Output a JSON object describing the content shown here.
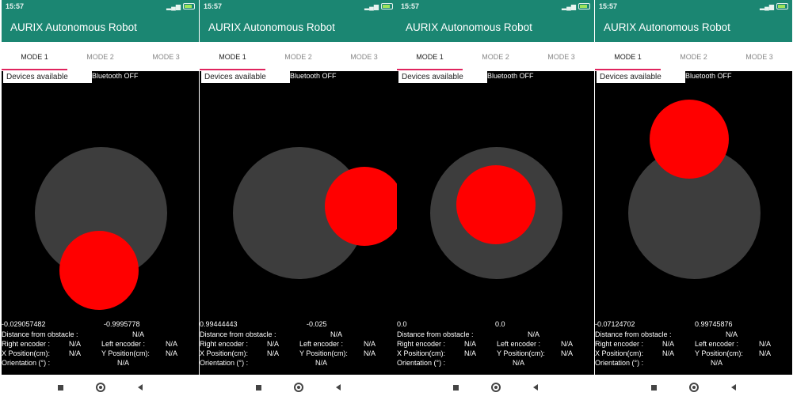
{
  "app_title": "AURIX Autonomous Robot",
  "tabs": [
    "MODE 1",
    "MODE 2",
    "MODE 3"
  ],
  "spinner_label": "Devices available",
  "bluetooth_status": "Bluetooth OFF",
  "labels": {
    "distance": "Distance from obstacle :",
    "right_encoder": "Right encoder :",
    "left_encoder": "Left encoder :",
    "x_position": "X Position(cm):",
    "y_position": "Y Position(cm):",
    "orientation": "Orientation (°) :"
  },
  "colors": {
    "primary": "#1b8672",
    "accent_tab": "#e0245e",
    "knob": "#ff0000",
    "joystick_base": "#3d3d3d"
  },
  "screens": [
    {
      "time": "15:57",
      "battery": "",
      "coord_x": "-0.029057482",
      "coord_y": "-0.9995778",
      "distance": "N/A",
      "right_encoder": "N/A",
      "left_encoder": "N/A",
      "x_position": "N/A",
      "y_position": "N/A",
      "orientation": "N/A",
      "knob_position": {
        "x": -0.029057482,
        "y": -0.9995778
      }
    },
    {
      "time": "15:57",
      "battery": "",
      "coord_x": "0.99444443",
      "coord_y": "-0.025",
      "distance": "N/A",
      "right_encoder": "N/A",
      "left_encoder": "N/A",
      "x_position": "N/A",
      "y_position": "N/A",
      "orientation": "N/A",
      "knob_position": {
        "x": 0.99444443,
        "y": -0.025
      }
    },
    {
      "time": "15:57",
      "battery": "",
      "coord_x": "0.0",
      "coord_y": "0.0",
      "distance": "N/A",
      "right_encoder": "N/A",
      "left_encoder": "N/A",
      "x_position": "N/A",
      "y_position": "N/A",
      "orientation": "N/A",
      "knob_position": {
        "x": 0.0,
        "y": 0.0
      }
    },
    {
      "time": "15:57",
      "battery": "",
      "coord_x": "-0.07124702",
      "coord_y": "0.99745876",
      "distance": "N/A",
      "right_encoder": "N/A",
      "left_encoder": "N/A",
      "x_position": "N/A",
      "y_position": "N/A",
      "orientation": "N/A",
      "knob_position": {
        "x": -0.07124702,
        "y": 0.99745876
      }
    }
  ]
}
